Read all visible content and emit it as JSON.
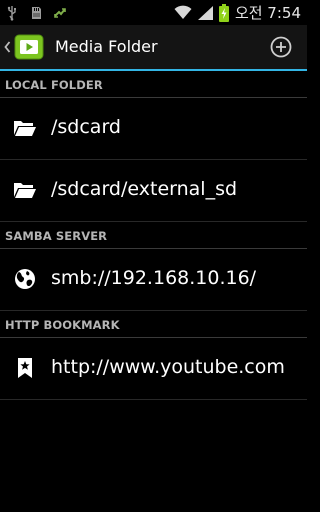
{
  "status_bar": {
    "left_icons": [
      "usb-icon",
      "sd-card-icon",
      "sync-icon"
    ],
    "right_icons": [
      "wifi-icon",
      "signal-icon",
      "battery-charging-icon"
    ],
    "time": "오전 7:54"
  },
  "action_bar": {
    "up_icon": "chevron-left-icon",
    "app_icon": "media-play-icon",
    "title": "Media Folder",
    "add_icon": "plus-circle-icon",
    "accent_color": "#33b5e5"
  },
  "sections": [
    {
      "header": "LOCAL FOLDER",
      "items": [
        {
          "icon": "folder-open-icon",
          "label": "/sdcard"
        },
        {
          "icon": "folder-open-icon",
          "label": "/sdcard/external_sd"
        }
      ]
    },
    {
      "header": "SAMBA SERVER",
      "items": [
        {
          "icon": "globe-icon",
          "label": "smb://192.168.10.16/"
        }
      ]
    },
    {
      "header": "HTTP BOOKMARK",
      "items": [
        {
          "icon": "bookmark-icon",
          "label": "http://www.youtube.com"
        }
      ]
    }
  ]
}
